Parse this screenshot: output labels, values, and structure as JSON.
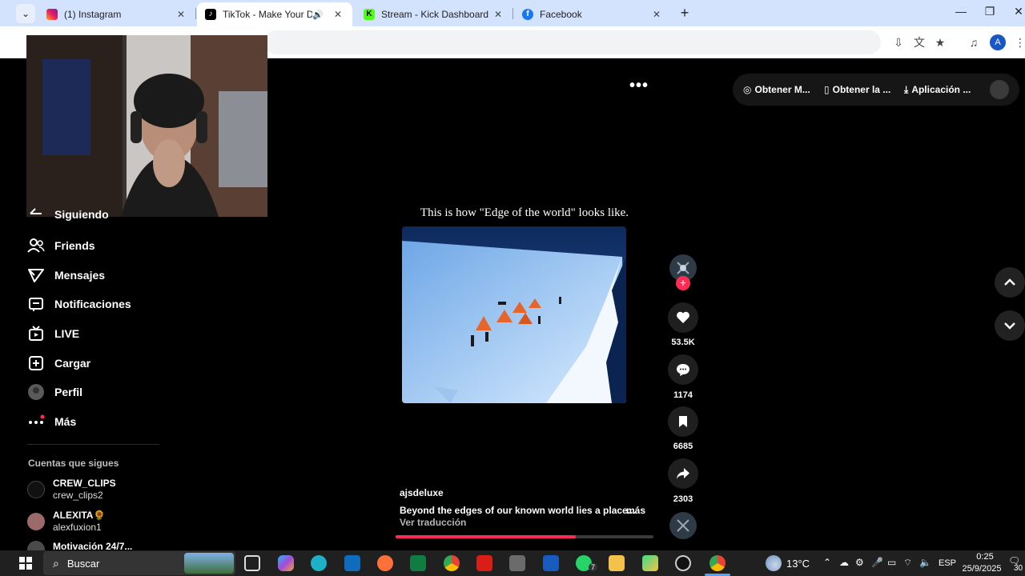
{
  "browser": {
    "tabs": [
      {
        "label": "(1) Instagram",
        "active": false
      },
      {
        "label": "TikTok - Make Your Day",
        "active": true
      },
      {
        "label": "Stream - Kick Dashboard",
        "active": false
      },
      {
        "label": "Facebook",
        "active": false
      }
    ],
    "newtab_glyph": "+",
    "close_glyph": "✕",
    "profile_initial": "A"
  },
  "topbar": {
    "more_glyph": "•••",
    "buttons": [
      {
        "label": "Obtener M..."
      },
      {
        "label": "Obtener la ..."
      },
      {
        "label": "Aplicación ..."
      }
    ]
  },
  "sidebar": {
    "items": [
      {
        "label": "Siguiendo"
      },
      {
        "label": "Friends"
      },
      {
        "label": "Mensajes"
      },
      {
        "label": "Notificaciones"
      },
      {
        "label": "LIVE"
      },
      {
        "label": "Cargar"
      },
      {
        "label": "Perfil"
      },
      {
        "label": "Más"
      }
    ],
    "following_title": "Cuentas que sigues",
    "accounts": [
      {
        "name": "CREW_CLIPS",
        "handle": "crew_clips2"
      },
      {
        "name": "ALEXITA🌻",
        "handle": "alexfuxion1"
      },
      {
        "name": "Motivación 24/7...",
        "handle": ""
      }
    ]
  },
  "video": {
    "caption": "This is how \"Edge of the world\" looks like.",
    "author": "ajsdeluxe",
    "description": "Beyond the edges of our known world lies a place...",
    "more_label": "más",
    "translate_label": "Ver traducción",
    "progress": 0.7
  },
  "actions": {
    "likes": "53.5K",
    "comments": "1174",
    "saves": "6685",
    "shares": "2303"
  },
  "taskbar": {
    "search_label": "Buscar",
    "weather": "13°C",
    "language": "ESP",
    "time": "0:25",
    "date": "25/9/2025",
    "whatsapp_badge": "7",
    "notif_count": "30"
  },
  "colors": {
    "accent": "#fe2c55",
    "tab_strip": "#d3e3fd",
    "taskbar": "#202020"
  }
}
